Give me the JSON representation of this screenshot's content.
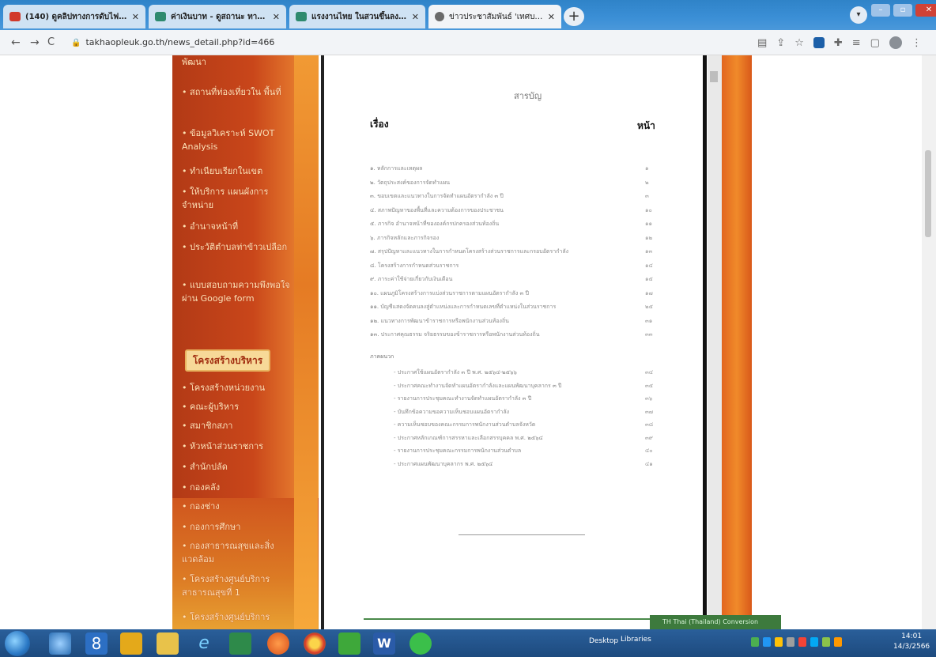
{
  "browser": {
    "tabs": [
      {
        "title": "(140) ดูคลิปทางการดับไฟ 6 บาท",
        "color": "#d13a2c",
        "active": false
      },
      {
        "title": "ค่าเงินบาท - ดูสถานะ ทางออก",
        "color": "#2e8a6e",
        "active": false
      },
      {
        "title": "แรงงานไทย ในสวนขึ้นลงเชิงทาง",
        "color": "#2e8a6e",
        "active": false
      },
      {
        "title": "ข่าวประชาสัมพันธ์ 'เทศบาลตำบล",
        "color": "#6a6a6a",
        "active": true
      }
    ],
    "new_tab": "+",
    "url": "takhaopleuk.go.th/news_detail.php?id=466",
    "back": "←",
    "forward": "→",
    "reload": "C"
  },
  "sidebar": {
    "menu_items": [
      "พัฒนา",
      "• สถานที่ท่องเที่ยวใน พื้นที่",
      "• ข้อมูลวิเคราะห์ SWOT Analysis",
      "• ทำเนียบเรียกในเขต",
      "• ให้บริการ แผนผังการจำหน่าย",
      "• อำนาจหน้าที่",
      "• ประวัติตำบลท่าข้าวเปลือก",
      "• แบบสอบถามความพึงพอใจผ่าน Google form"
    ],
    "section_title": "โครงสร้างบริหาร",
    "structure_items": [
      "• โครงสร้างหน่วยงาน",
      "• คณะผู้บริหาร",
      "• สมาชิกสภา",
      "• หัวหน้าส่วนราชการ",
      "• สำนักปลัด",
      "• กองคลัง",
      "• กองช่าง",
      "• กองการศึกษา",
      "• กองสาธารณสุขและสิ่งแวดล้อม",
      "• โครงสร้างศูนย์บริการสาธารณสุขที่ 1",
      "• โครงสร้างศูนย์บริการ"
    ]
  },
  "document": {
    "title": "สารบัญ",
    "col_left": "เรื่อง",
    "col_right": "หน้า",
    "toc": [
      {
        "text": "๑. หลักการและเหตุผล",
        "page": "๑"
      },
      {
        "text": "๒. วัตถุประสงค์ของการจัดทำแผน",
        "page": "๒"
      },
      {
        "text": "๓. ขอบเขตและแนวทางในการจัดทำแผนอัตรากำลัง ๓ ปี",
        "page": "๓"
      },
      {
        "text": "๔. สภาพปัญหาของพื้นที่และความต้องการของประชาชน",
        "page": "๑๐"
      },
      {
        "text": "๕. ภารกิจ อำนาจหน้าที่ขององค์กรปกครองส่วนท้องถิ่น",
        "page": "๑๑"
      },
      {
        "text": "๖. ภารกิจหลักและภารกิจรอง",
        "page": "๑๒"
      },
      {
        "text": "๗. สรุปปัญหาและแนวทางในการกำหนดโครงสร้างส่วนราชการและกรอบอัตรากำลัง",
        "page": "๑๓"
      },
      {
        "text": "๘. โครงสร้างการกำหนดส่วนราชการ",
        "page": "๑๔"
      },
      {
        "text": "๙. ภาระค่าใช้จ่ายเกี่ยวกับเงินเดือน",
        "page": "๑๕"
      },
      {
        "text": "๑๐. แผนภูมิโครงสร้างการแบ่งส่วนราชการตามแผนอัตรากำลัง ๓ ปี",
        "page": "๑๗"
      },
      {
        "text": "๑๑. บัญชีแสดงจัดคนลงสู่ตำแหน่งและการกำหนดเลขที่ตำแหน่งในส่วนราชการ",
        "page": "๒๕"
      },
      {
        "text": "๑๒. แนวทางการพัฒนาข้าราชการหรือพนักงานส่วนท้องถิ่น",
        "page": "๓๑"
      },
      {
        "text": "๑๓. ประกาศคุณธรรม จริยธรรมของข้าราชการหรือพนักงานส่วนท้องถิ่น",
        "page": "๓๓"
      }
    ],
    "appendix_label": "ภาคผนวก",
    "appendix": [
      {
        "text": "- ประกาศใช้แผนอัตรากำลัง ๓ ปี พ.ศ. ๒๕๖๔-๒๕๖๖",
        "page": "๓๔"
      },
      {
        "text": "- ประกาศคณะทำงานจัดทำแผนอัตรากำลังและแผนพัฒนาบุคลากร ๓ ปี",
        "page": "๓๕"
      },
      {
        "text": "- รายงานการประชุมคณะทำงานจัดทำแผนอัตรากำลัง ๓ ปี",
        "page": "๓๖"
      },
      {
        "text": "- บันทึกข้อความขอความเห็นชอบแผนอัตรากำลัง",
        "page": "๓๗"
      },
      {
        "text": "- ความเห็นชอบของคณะกรรมการพนักงานส่วนตำบลจังหวัด",
        "page": "๓๘"
      },
      {
        "text": "- ประกาศหลักเกณฑ์การสรรหาและเลือกสรรบุคคล พ.ศ. ๒๕๖๔",
        "page": "๓๙"
      },
      {
        "text": "- รายงานการประชุมคณะกรรมการพนักงานส่วนตำบล",
        "page": "๔๐"
      },
      {
        "text": "- ประกาศแผนพัฒนาบุคลากร พ.ศ. ๒๕๖๔",
        "page": "๔๑"
      }
    ]
  },
  "language_bar": "TH Thai (Thailand)  Conversion",
  "taskbar": {
    "desktop": "Desktop",
    "libraries": "Libraries",
    "time": "14:01",
    "date": "14/3/2566"
  },
  "colors": {
    "sidebar_dark": "#b23a16",
    "sidebar_light": "#ef9a34",
    "tab_bar": "#3b8fd6",
    "taskbar": "#1d4a7e"
  }
}
